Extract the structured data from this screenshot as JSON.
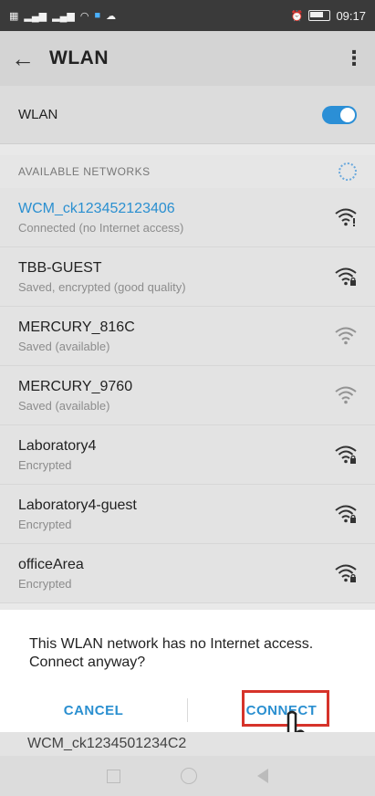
{
  "statusbar": {
    "left_icons": [
      "sim-icon",
      "signal-icon",
      "signal-icon",
      "wifi-icon",
      "notification-icon",
      "cloud-icon"
    ],
    "right_icons": [
      "alarm-icon",
      "battery-icon"
    ],
    "time": "09:17"
  },
  "appbar": {
    "title": "WLAN",
    "back_icon": "arrow-left",
    "menu_icon": "more-vertical"
  },
  "wlan_toggle": {
    "label": "WLAN",
    "state": "on",
    "accent": "#2b8fd6"
  },
  "section": {
    "title": "AVAILABLE NETWORKS"
  },
  "networks": [
    {
      "name": "WCM_ck123452123406",
      "status": "Connected (no Internet access)",
      "connected": true,
      "secured": false
    },
    {
      "name": "TBB-GUEST",
      "status": "Saved, encrypted (good quality)",
      "connected": false,
      "secured": true
    },
    {
      "name": "MERCURY_816C",
      "status": "Saved (available)",
      "connected": false,
      "secured": false
    },
    {
      "name": "MERCURY_9760",
      "status": "Saved (available)",
      "connected": false,
      "secured": false
    },
    {
      "name": "Laboratory4",
      "status": "Encrypted",
      "connected": false,
      "secured": true
    },
    {
      "name": "Laboratory4-guest",
      "status": "Encrypted",
      "connected": false,
      "secured": true
    },
    {
      "name": "officeArea",
      "status": "Encrypted",
      "connected": false,
      "secured": true
    }
  ],
  "dialog": {
    "message": "This WLAN network has no Internet access. Connect anyway?",
    "cancel_label": "CANCEL",
    "connect_label": "CONNECT",
    "highlight_color": "#d6332a"
  },
  "peek_network": {
    "name": "WCM_ck1234501234C2"
  }
}
